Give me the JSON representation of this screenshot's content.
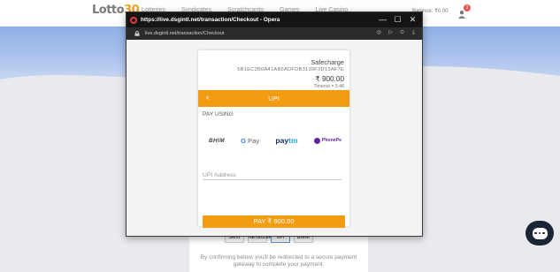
{
  "background_site": {
    "logo_text": "Lotto",
    "logo_number": "30",
    "nav_items": [
      "Lotteries",
      "Syndicates",
      "Scratchcards",
      "Games",
      "Live Casino"
    ],
    "balance_text": "Balance: ₹0.00",
    "notification_count": "3",
    "payment_logos": [
      "Skrill",
      "NETELLER",
      "UPI",
      "BANK"
    ],
    "disclaimer": "By confirming below, you'll be redirected to a secure payment gateway to complete your payment."
  },
  "browser": {
    "window_title": "https://live.dsgintl.net/transaction/Checkout - Opera",
    "url": "live.dsgintl.net/transaction/Checkout",
    "controls": {
      "minimize": "—",
      "maximize": "☐",
      "close": "✕"
    }
  },
  "checkout": {
    "merchant": "Safecharge",
    "transaction_id": "5B1EC2B0A41AB5ADFDB3139F3D13AF7E",
    "amount": "₹ 900.00",
    "timeout": "Timeout = 5:48",
    "header_title": "UPI",
    "back_glyph": "‹",
    "pay_using_label": "PAY USING",
    "apps": {
      "bhim": "BHIM",
      "gpay_g": "G",
      "gpay_pay": "Pay",
      "paytm_pay": "pay",
      "paytm_tm": "tm",
      "phonepe": "PhonePe"
    },
    "upi_address_placeholder": "UPI Address",
    "pay_button_label": "PAY ₹ 900.00"
  },
  "colors": {
    "accent": "#f39c12",
    "titlebar": "#141414",
    "chat_button": "#1c2536"
  }
}
